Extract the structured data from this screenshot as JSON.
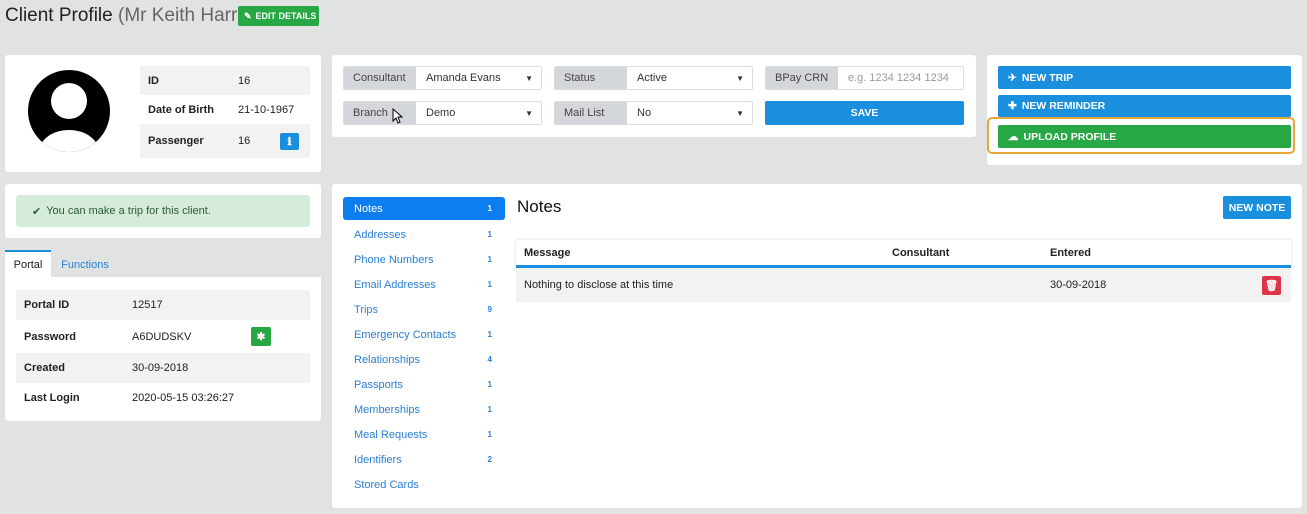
{
  "header": {
    "title": "Client Profile",
    "client_name": "(Mr Keith Harris)",
    "edit_label": "EDIT DETAILS"
  },
  "profile": {
    "rows": [
      {
        "label": "ID",
        "value": "16"
      },
      {
        "label": "Date of Birth",
        "value": "21-10-1967"
      },
      {
        "label": "Passenger",
        "value": "16"
      }
    ]
  },
  "form": {
    "consultant": {
      "label": "Consultant",
      "value": "Amanda Evans"
    },
    "status": {
      "label": "Status",
      "value": "Active"
    },
    "bpay": {
      "label": "BPay CRN",
      "placeholder": "e.g. 1234 1234 1234"
    },
    "branch": {
      "label": "Branch",
      "value": "Demo"
    },
    "mail_list": {
      "label": "Mail List",
      "value": "No"
    },
    "save_label": "SAVE"
  },
  "actions": {
    "new_trip": "NEW TRIP",
    "new_reminder": "NEW REMINDER",
    "upload_profile": "UPLOAD PROFILE"
  },
  "alert": {
    "text": "You can make a trip for this client."
  },
  "portal": {
    "tabs": [
      "Portal",
      "Functions"
    ],
    "rows": [
      {
        "label": "Portal ID",
        "value": "12517"
      },
      {
        "label": "Password",
        "value": "A6DUDSKV"
      },
      {
        "label": "Created",
        "value": "30-09-2018"
      },
      {
        "label": "Last Login",
        "value": "2020-05-15 03:26:27"
      }
    ]
  },
  "nav": [
    {
      "label": "Notes",
      "count": "1"
    },
    {
      "label": "Addresses",
      "count": "1"
    },
    {
      "label": "Phone Numbers",
      "count": "1"
    },
    {
      "label": "Email Addresses",
      "count": "1"
    },
    {
      "label": "Trips",
      "count": "9"
    },
    {
      "label": "Emergency Contacts",
      "count": "1"
    },
    {
      "label": "Relationships",
      "count": "4"
    },
    {
      "label": "Passports",
      "count": "1"
    },
    {
      "label": "Memberships",
      "count": "1"
    },
    {
      "label": "Meal Requests",
      "count": "1"
    },
    {
      "label": "Identifiers",
      "count": "2"
    },
    {
      "label": "Stored Cards",
      "count": ""
    }
  ],
  "notes": {
    "title": "Notes",
    "new_label": "NEW NOTE",
    "columns": [
      "Message",
      "Consultant",
      "Entered"
    ],
    "rows": [
      {
        "message": "Nothing to disclose at this time",
        "consultant": "",
        "entered": "30-09-2018"
      }
    ]
  },
  "colors": {
    "green": "#28a745",
    "blue": "#1a8fdd",
    "nav_active": "#0d7ef0",
    "highlight": "#e8a735"
  }
}
